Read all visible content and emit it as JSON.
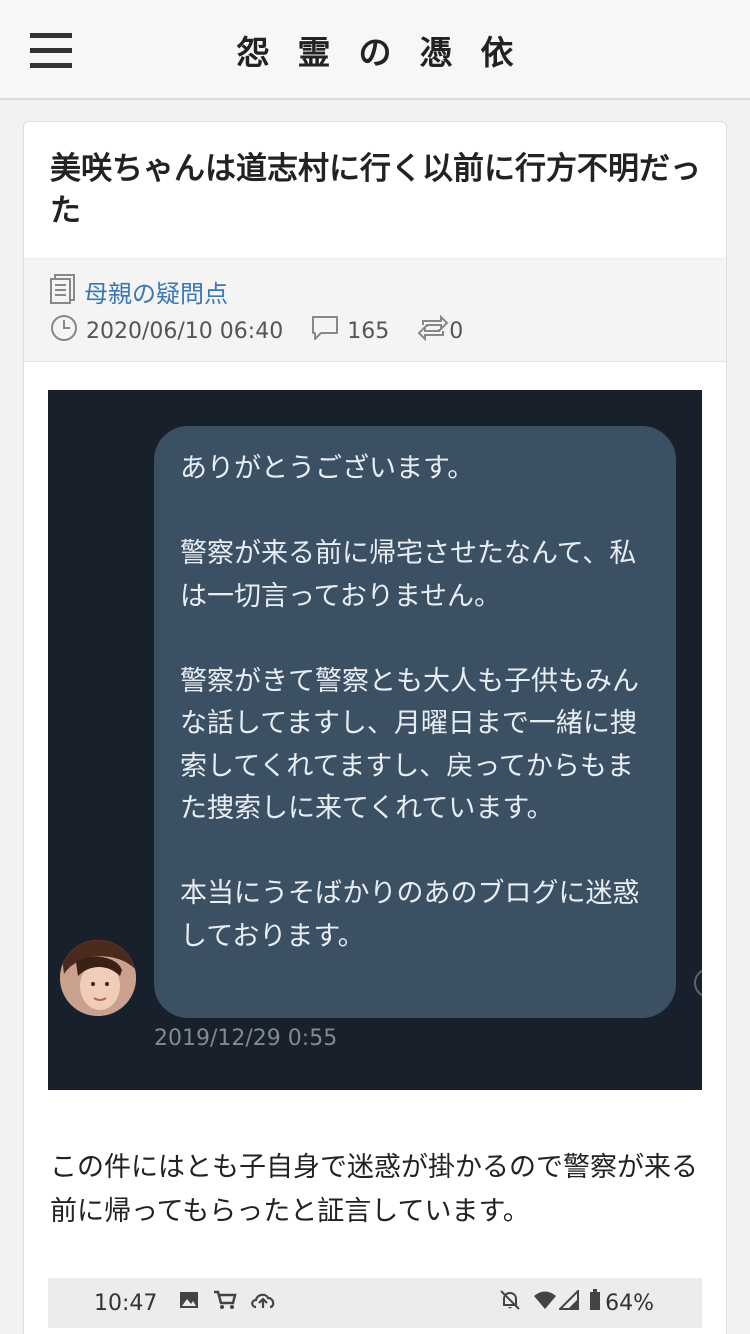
{
  "header": {
    "site_title": "怨霊の憑依"
  },
  "post": {
    "title": "美咲ちゃんは道志村に行く以前に行方不明だった",
    "category": "母親の疑問点",
    "datetime": "2020/06/10 06:40",
    "comments": "165",
    "reposts": "0"
  },
  "screenshot": {
    "message": "ありがとうございます。\n\n警察が来る前に帰宅させたなんて、私は一切言っておりません。\n\n警察がきて警察とも大人も子供もみんな話してますし、月曜日まで一緒に捜索してくれてますし、戻ってからもまた捜索しに来てくれています。\n\n本当にうそばかりのあのブログに迷惑しております。",
    "timestamp": "2019/12/29 0:55"
  },
  "body": {
    "paragraph": "この件にはとも子自身で迷惑が掛かるので警察が来る前に帰ってもらったと証言しています。"
  },
  "phone_status": {
    "time": "10:47",
    "battery": "64%"
  },
  "icons": [
    "menu-icon",
    "document-icon",
    "clock-icon",
    "comment-icon",
    "repost-icon",
    "image-icon",
    "cart-icon",
    "cloud-upload-icon",
    "notifications-off-icon",
    "wifi-icon",
    "signal-icon",
    "battery-icon"
  ],
  "colors": {
    "link": "#3a78b5",
    "bubble": "#3c5064",
    "chat_bg": "#17202b"
  }
}
